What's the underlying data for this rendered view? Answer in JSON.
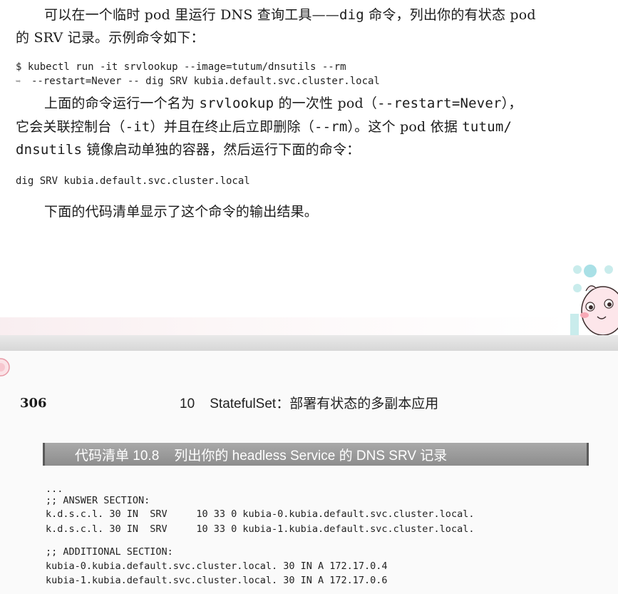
{
  "top_page": {
    "para1_line1": "可以在一个临时 pod 里运行 DNS 查询工具——",
    "para1_line1_code": "dig",
    "para1_line1_rest": " 命令，列出你的有状态 pod",
    "para1_line2": "的 SRV 记录。示例命令如下：",
    "cmd_line1": "$ kubectl run -it srvlookup --image=tutum/dnsutils --rm",
    "cmd_continue_icon": "continuation-arrow-icon",
    "cmd_line2": "--restart=Never -- dig SRV kubia.default.svc.cluster.local",
    "para2_line1_a": "上面的命令运行一个名为 ",
    "para2_line1_code1": "srvlookup",
    "para2_line1_b": " 的一次性 pod（",
    "para2_line1_code2": "--restart=Never",
    "para2_line1_c": "），",
    "para2_line2_a": "它会关联控制台（",
    "para2_line2_code1": "-it",
    "para2_line2_b": "）并且在终止后立即删除（",
    "para2_line2_code2": "--rm",
    "para2_line2_c": "）。这个 pod 依据 ",
    "para2_line2_code3": "tutum/",
    "para2_line3_code": "dnsutils",
    "para2_line3_rest": " 镜像启动单独的容器，然后运行下面的命令：",
    "cmd2": "dig SRV kubia.default.svc.cluster.local",
    "para3": "下面的代码清单显示了这个命令的输出结果。"
  },
  "bottom_page": {
    "page_number": "306",
    "chapter_title": "10    StatefulSet：部署有状态的多副本应用",
    "listing_title": "代码清单 10.8    列出你的 headless Service 的 DNS SRV 记录",
    "listing_lines": [
      "...",
      ";; ANSWER SECTION:",
      "k.d.s.c.l. 30 IN  SRV     10 33 0 kubia-0.kubia.default.svc.cluster.local.",
      "k.d.s.c.l. 30 IN  SRV     10 33 0 kubia-1.kubia.default.svc.cluster.local.",
      "",
      ";; ADDITIONAL SECTION:",
      "kubia-0.kubia.default.svc.cluster.local. 30 IN A 172.17.0.4",
      "kubia-1.kubia.default.svc.cluster.local. 30 IN A 172.17.0.6"
    ]
  },
  "decor": {
    "mascot_icon": "cartoon-mascot-icon",
    "corner_icon": "page-corner-mark-icon"
  }
}
